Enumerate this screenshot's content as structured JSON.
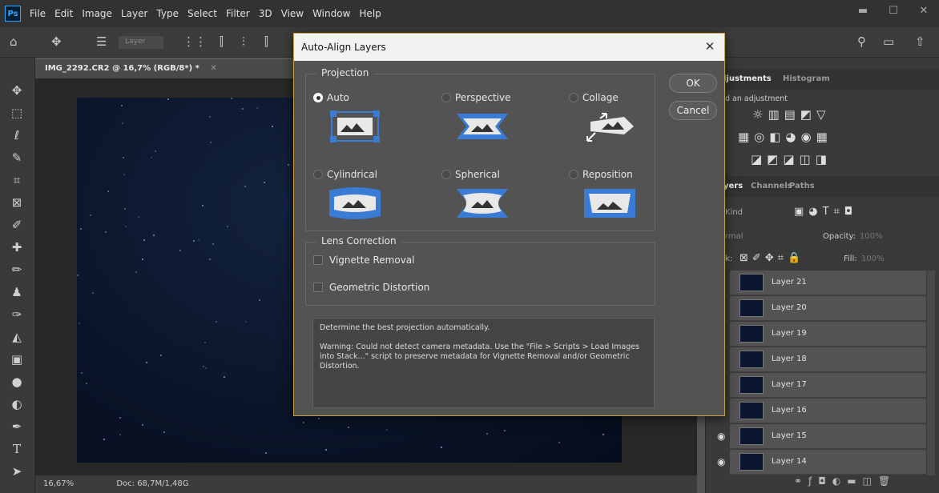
{
  "app": {
    "logo": "Ps",
    "menus": [
      "File",
      "Edit",
      "Image",
      "Layer",
      "Type",
      "Select",
      "Filter",
      "3D",
      "View",
      "Window",
      "Help"
    ]
  },
  "options_bar": {
    "layer_select": "Layer"
  },
  "document": {
    "tab_title": "IMG_2292.CR2 @ 16,7% (RGB/8*) *",
    "zoom": "16,67%",
    "doc_info": "Doc: 68,7M/1,48G"
  },
  "adjustments": {
    "tabs": [
      "ljustments",
      "Histogram"
    ],
    "hint": "d an adjustment"
  },
  "layers": {
    "tabs": [
      "yers",
      "Channels",
      "Paths"
    ],
    "filter": "Kind",
    "blend_mode": "rmal",
    "opacity_label": "Opacity:",
    "opacity_value": "100%",
    "lock_label": "k:",
    "fill_label": "Fill:",
    "fill_value": "100%",
    "rows": [
      "Layer 21",
      "Layer 20",
      "Layer 19",
      "Layer 18",
      "Layer 17",
      "Layer 16",
      "Layer 15",
      "Layer 14"
    ]
  },
  "dialog": {
    "title": "Auto-Align Layers",
    "projection_label": "Projection",
    "options": [
      "Auto",
      "Perspective",
      "Collage",
      "Cylindrical",
      "Spherical",
      "Reposition"
    ],
    "selected": "Auto",
    "lens_label": "Lens Correction",
    "checks": [
      "Vignette Removal",
      "Geometric Distortion"
    ],
    "ok": "OK",
    "cancel": "Cancel",
    "desc_line1": "Determine the best projection automatically.",
    "desc_line2": "Warning: Could not detect camera metadata. Use the \"File > Scripts > Load Images into Stack...\" script to preserve metadata for Vignette Removal and/or Geometric Distortion."
  },
  "colors": {
    "accent": "#3a7bd5",
    "dialog_border": "#c8a04a"
  }
}
